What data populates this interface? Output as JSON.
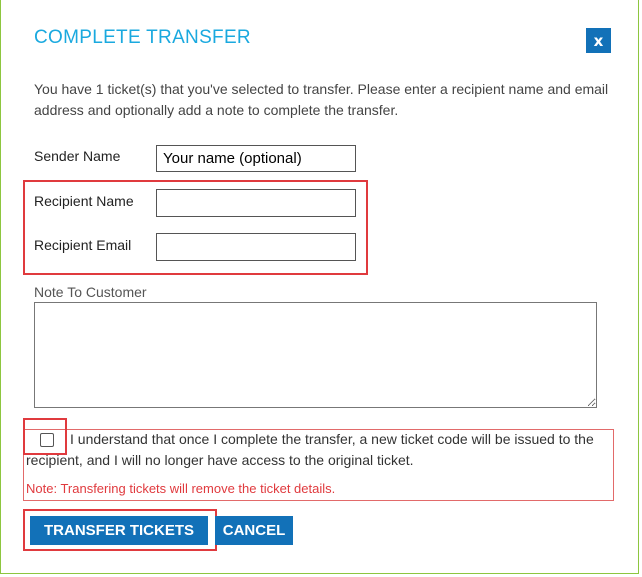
{
  "dialog": {
    "title": "COMPLETE TRANSFER",
    "close_label": "x",
    "intro": "You have 1 ticket(s) that you've selected to transfer. Please enter a recipient name and email address and optionally add a note to complete the transfer."
  },
  "form": {
    "sender_label": "Sender Name",
    "sender_placeholder": "Your name (optional)",
    "recipient_name_label": "Recipient Name",
    "recipient_name_value": "",
    "recipient_email_label": "Recipient Email",
    "recipient_email_value": "",
    "note_label": "Note To Customer",
    "note_value": ""
  },
  "terms": {
    "checked": false,
    "text": "I understand that once I complete the transfer, a new ticket code will be issued to the recipient, and I will no longer have access to the original ticket.",
    "note": "Note: Transfering tickets will remove the ticket details."
  },
  "actions": {
    "transfer_label": "TRANSFER TICKETS",
    "cancel_label": "CANCEL"
  },
  "colors": {
    "title": "#1aa9df",
    "button": "#1271b8",
    "highlight": "#e03a3e",
    "dialog_border": "#8dc63f"
  }
}
